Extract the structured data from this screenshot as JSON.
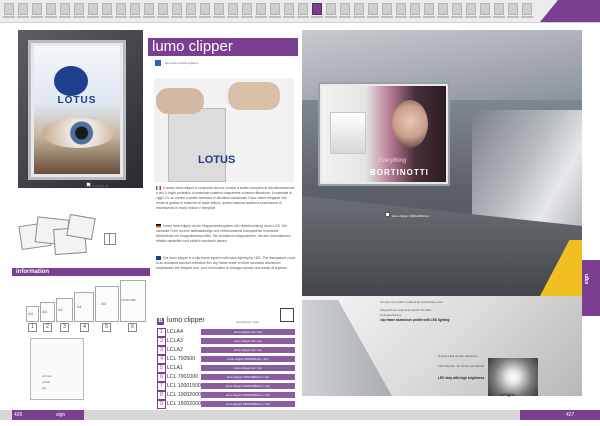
{
  "header": {
    "title": "lumo clipper",
    "subtitle": "aluminium frame lightbox"
  },
  "section_label": "sign",
  "captions": {
    "left_photo": "lumo clipper A1",
    "right_photo": "lumo clipper 1500x1000mm"
  },
  "body": {
    "paragraphs": [
      "Il nostro lumo clipper è composto da una cornice a scatto completa di retroilluminazione a led. Il foglio protettivo in materiale sintetico trasparente a bassa riflessione. Il materiale di oggi LGL la cornice a scatto standard in alluminio anodizzato il suo colore elegante che rende la grafica al massimo di facile lettura, questo sistema facilita la sostituzione di informazioni in modo veloce e semplice.",
      "Unser lumo clipper ist ein Klapprahmensystem mit Hinterleuchtung durch LED. Die schlanke Form ist eine selbstständige und reflexionsarme transparente Kunststoff-Abdeckfolie mit Klapprahmenprofilen. Die Aluminium-Klapprahmen, die den Informationen effektiv darstellen und einfach wechseln lassen.",
      "Our lumo clipper is a clip-frame system with back-lighting by LED. The transparent cover is an anodised and anti-reflective film clip frame made of silver anodised aluminium emphasizes the elegant look, your information is changed quickly and easily at anytime."
    ]
  },
  "information": {
    "label": "information",
    "sizes": [
      "A4",
      "A3",
      "A2",
      "A1",
      "A0",
      "1500x1000"
    ],
    "numbers": [
      "1",
      "2",
      "3",
      "4",
      "5",
      "6"
    ],
    "diagram_lines": [
      "cornice",
      "profilo",
      "led"
    ]
  },
  "table": {
    "title": "lumo clipper",
    "header": "descrizione / size",
    "rows": [
      {
        "num": "1",
        "name": "LCLA4",
        "desc": "lumo clipper A4 / 1pz"
      },
      {
        "num": "2",
        "name": "LCLA3",
        "desc": "lumo clipper A3 / 1pz"
      },
      {
        "num": "3",
        "name": "LCLA2",
        "desc": "lumo clipper A2 / 1pz"
      },
      {
        "num": "4",
        "name": "LCL 700500",
        "desc": "lumo clipper 700x500mm / 1pz"
      },
      {
        "num": "5",
        "name": "LCLA1",
        "desc": "lumo clipper A1 / 1pz"
      },
      {
        "num": "6",
        "name": "LCL 7001000",
        "desc": "lumo clipper 700x1000mm / 1pz"
      },
      {
        "num": "7",
        "name": "LCL 10001500",
        "desc": "lumo clipper 1000x1500mm / 1pz"
      },
      {
        "num": "8",
        "name": "LCL 10002000",
        "desc": "lumo clipper 1000x2000mm / 1pz"
      },
      {
        "num": "9",
        "name": "LCL 15002000",
        "desc": "lumo clipper 1500x2000mm / 1pz"
      }
    ]
  },
  "detail": {
    "top_text": "cornice con profilo in alluminio anodizzato e led",
    "mid_text": "Klapprahmen-Aluminiumprofil mit LED-Hinterleuchtung",
    "bold_text": "clip frame aluminium profile with LED lighting",
    "led_text1": "striscia LED ad alta efficienza",
    "led_text2": "LED-Streifen mit hoher Leuchtkraft",
    "led_bold": "LED strip with high brightness",
    "led_label": "led lights"
  },
  "billboard": {
    "line1": "Everything",
    "line2": "BORTINOTTI"
  },
  "footer": {
    "page_left": "426",
    "section_left": "sign",
    "page_right": "427"
  },
  "colors": {
    "accent": "#7a3f91",
    "accent_light": "#8a5da0"
  }
}
